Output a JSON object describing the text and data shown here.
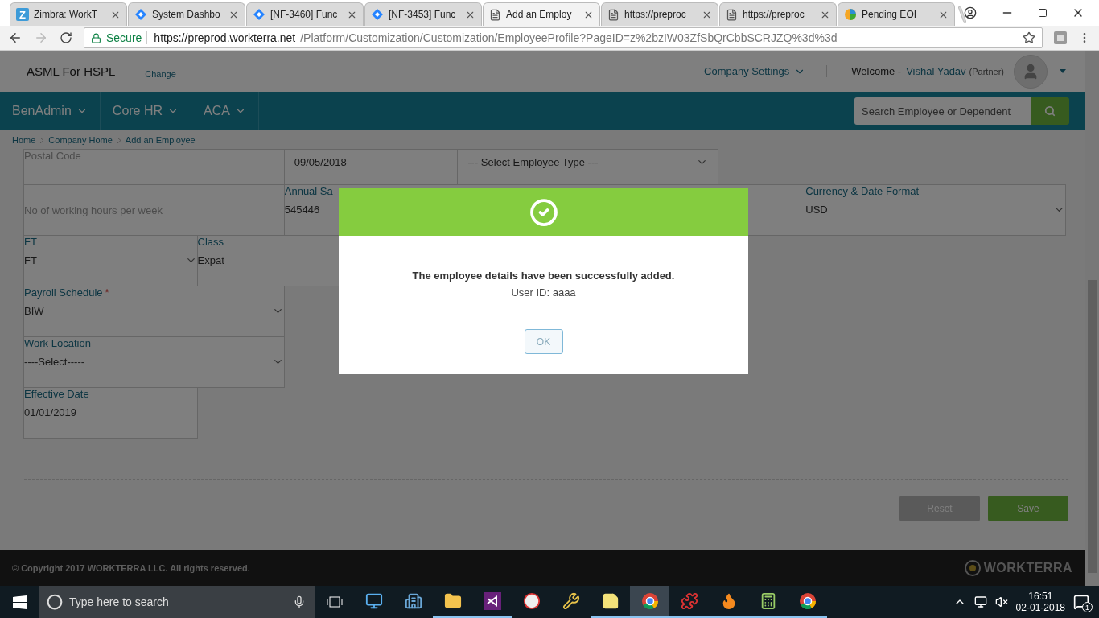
{
  "browser": {
    "tabs": [
      {
        "title": "Zimbra: WorkT",
        "kind": "letter",
        "icon_text": "Z",
        "selected": false
      },
      {
        "title": "System Dashbo",
        "kind": "diamond",
        "selected": false
      },
      {
        "title": "[NF-3460] Func",
        "kind": "diamond",
        "selected": false
      },
      {
        "title": "[NF-3453] Func",
        "kind": "diamond",
        "selected": false
      },
      {
        "title": "Add an Employ",
        "kind": "page",
        "selected": true
      },
      {
        "title": "https://preproc",
        "kind": "page",
        "selected": false
      },
      {
        "title": "https://preproc",
        "kind": "page",
        "selected": false
      },
      {
        "title": "Pending EOI",
        "kind": "pie",
        "selected": false
      }
    ],
    "security": "Secure",
    "url_domain": "https://preprod.workterra.net",
    "url_path": "/Platform/Customization/Customization/EmployeeProfile?PageID=z%2bzIW03ZfSbQrCbbSCRJZQ%3d%3d"
  },
  "header": {
    "company": "ASML For HSPL",
    "change_link": "Change",
    "settings_menu": "Company Settings",
    "welcome": "Welcome -",
    "user_name": "Vishal Yadav",
    "user_role": "(Partner)"
  },
  "nav": {
    "items": [
      {
        "label": "BenAdmin"
      },
      {
        "label": "Core HR"
      },
      {
        "label": "ACA"
      }
    ],
    "search": {
      "placeholder": "Search Employee or Dependent"
    }
  },
  "breadcrumb": [
    "Home",
    "Company Home",
    "Add an Employee"
  ],
  "form": {
    "rows": [
      [
        {
          "kind": "placeholder",
          "label": "Postal Code"
        },
        {
          "kind": "text",
          "value": "09/05/2018"
        },
        {
          "kind": "select",
          "value": "--- Select Employee Type ---"
        }
      ],
      [
        {
          "kind": "placeholder",
          "label": "No of working hours per week"
        },
        {
          "kind": "text",
          "label": "Annual Sa",
          "value": "545446"
        },
        {
          "kind": "blank"
        },
        {
          "kind": "select",
          "label": "Currency & Date Format",
          "value": "USD"
        }
      ],
      [
        {
          "kind": "select",
          "label": "FT",
          "value": "FT"
        },
        {
          "kind": "text",
          "label": "Class",
          "value": "Expat"
        }
      ],
      [
        {
          "kind": "select",
          "label": "Payroll Schedule",
          "required_mark": "*",
          "value": "BIW"
        }
      ],
      [
        {
          "kind": "select",
          "label": "Work Location",
          "value": "----Select-----"
        }
      ],
      [
        {
          "kind": "text",
          "label": "Effective Date",
          "value": "01/01/2019"
        }
      ]
    ]
  },
  "actions": [
    {
      "label": "Reset",
      "kind": "secondary"
    },
    {
      "label": "Save",
      "kind": "primary"
    }
  ],
  "footer": {
    "copyright": "© Copyright 2017 WORKTERRA LLC. All rights reserved.",
    "brand": "WORKTERRA"
  },
  "dialog": {
    "message": "The employee details have been successfully added.",
    "user_id": "User ID: aaaa",
    "button": "OK"
  },
  "taskbar": {
    "search_placeholder": "Type here to search",
    "apps": [
      {
        "running": false,
        "selected": false
      },
      {
        "running": false,
        "selected": false
      },
      {
        "running": true,
        "selected": false
      },
      {
        "running": true,
        "selected": false
      },
      {
        "running": false,
        "selected": false
      },
      {
        "running": false,
        "selected": false
      },
      {
        "running": true,
        "selected": false
      },
      {
        "running": true,
        "selected": true
      },
      {
        "running": true,
        "selected": false
      },
      {
        "running": true,
        "selected": false
      },
      {
        "running": true,
        "selected": false
      },
      {
        "running": true,
        "selected": false
      }
    ],
    "time": "16:51",
    "date": "02-01-2018",
    "notifications": "1"
  }
}
